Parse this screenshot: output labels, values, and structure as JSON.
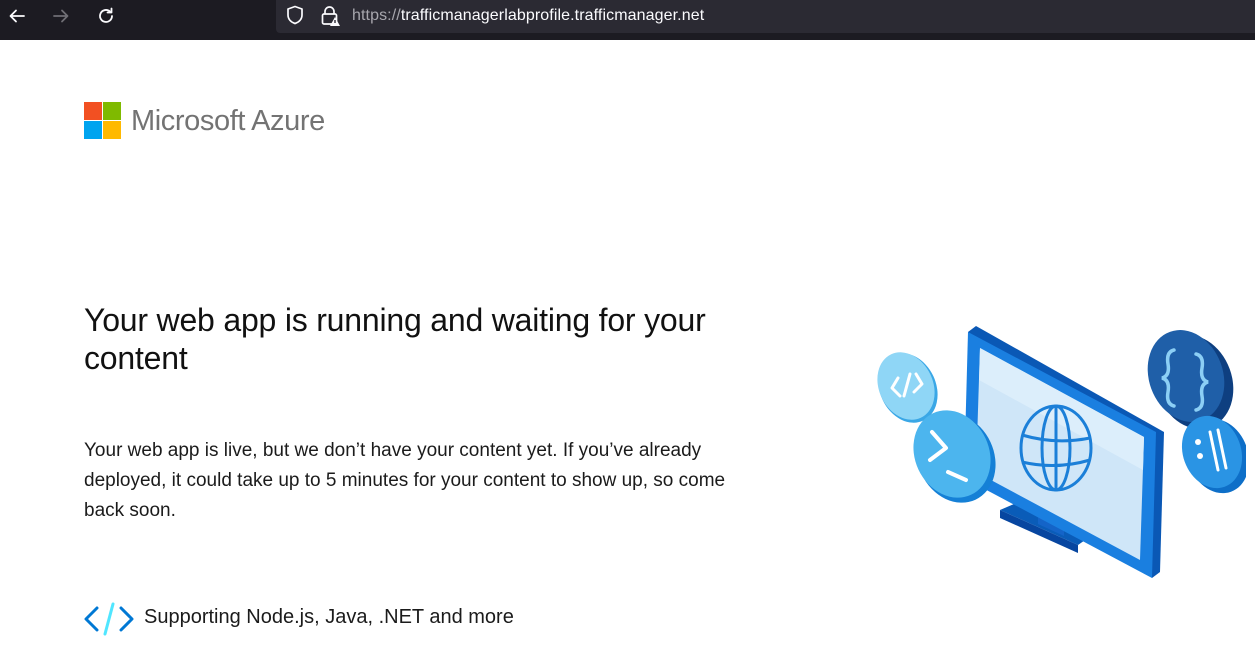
{
  "browser": {
    "url_scheme": "https://",
    "url_host": "trafficmanagerlabprofile.trafficmanager.net"
  },
  "logo": {
    "text": "Microsoft Azure",
    "colors": [
      "#f25022",
      "#7fba00",
      "#00a4ef",
      "#ffb900"
    ]
  },
  "main": {
    "headline": "Your web app is running and waiting for your content",
    "body": "Your web app is live, but we don’t have your content yet. If you’ve already deployed, it could take up to 5 minutes for your content to show up, so come back soon.",
    "support_text": "Supporting Node.js, Java, .NET and more"
  },
  "icons": {
    "back": "arrow-left-icon",
    "forward": "arrow-right-icon",
    "reload": "reload-icon",
    "shield": "shield-icon",
    "lock": "lock-warning-icon",
    "code": "code-brackets-icon",
    "illustration": "monitor-globe-illustration"
  },
  "theme": {
    "accent": "#0078d4",
    "browser_bg": "#1c1b22",
    "urlbar_bg": "#2b2a33"
  }
}
